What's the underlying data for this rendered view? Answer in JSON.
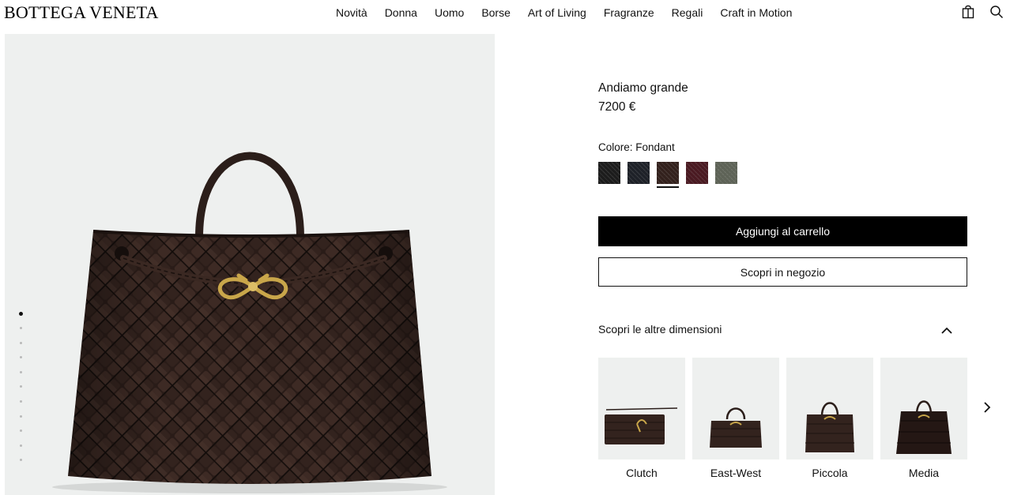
{
  "brand": {
    "logo": "BOTTEGA VENETA"
  },
  "nav": {
    "items": [
      "Novità",
      "Donna",
      "Uomo",
      "Borse",
      "Art of Living",
      "Fragranze",
      "Regali",
      "Craft in Motion"
    ]
  },
  "header_icons": [
    "shopping-bag-icon",
    "search-icon"
  ],
  "gallery": {
    "dots_total": 11,
    "active_index": 0,
    "background": "#eef0ef"
  },
  "product": {
    "name": "Andiamo grande",
    "price": "7200 €",
    "color_label": "Colore: Fondant",
    "swatches": [
      {
        "name": "nero",
        "color": "#1c1c1c",
        "selected": false
      },
      {
        "name": "blu scuro",
        "color": "#1e2128",
        "selected": false
      },
      {
        "name": "fondant",
        "color": "#33211d",
        "selected": true
      },
      {
        "name": "bordeaux",
        "color": "#4a1a22",
        "selected": false
      },
      {
        "name": "verde",
        "color": "#5e6357",
        "selected": false
      }
    ]
  },
  "buttons": {
    "add_to_cart": "Aggiungi al carrello",
    "find_in_store": "Scopri in negozio"
  },
  "sizes": {
    "title": "Scopri le altre dimensioni",
    "items": [
      {
        "label": "Clutch"
      },
      {
        "label": "East-West"
      },
      {
        "label": "Piccola"
      },
      {
        "label": "Media"
      }
    ]
  }
}
